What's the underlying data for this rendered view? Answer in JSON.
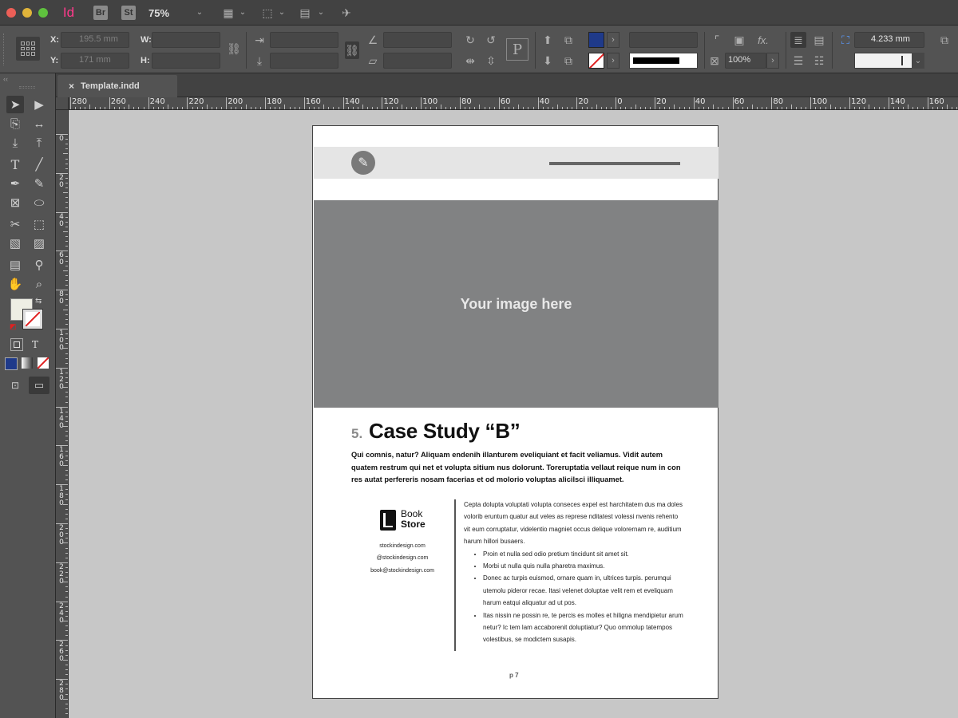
{
  "app": {
    "logo": "Id",
    "bridge": "Br",
    "stock": "St",
    "zoom": "75%"
  },
  "control": {
    "x_label": "X:",
    "y_label": "Y:",
    "w_label": "W:",
    "h_label": "H:",
    "x_value": "195.5 mm",
    "y_value": "171 mm",
    "opacity": "100%",
    "gap": "4.233 mm",
    "fill_color": "#1f3a8a"
  },
  "tab": {
    "close": "×",
    "title": "Template.indd"
  },
  "ruler": {
    "h": [
      "280",
      "260",
      "240",
      "220",
      "200",
      "180",
      "160",
      "140",
      "120",
      "100",
      "80",
      "60",
      "40",
      "20",
      "0",
      "20",
      "40",
      "60",
      "80",
      "100",
      "120",
      "140",
      "160",
      "1"
    ],
    "v": [
      "0",
      "20",
      "40",
      "60",
      "80",
      "100",
      "120",
      "140",
      "160",
      "180",
      "200",
      "220",
      "240",
      "260",
      "280"
    ]
  },
  "doc": {
    "image_placeholder": "Your image here",
    "case_number": "5.",
    "case_title": "Case Study “B”",
    "intro": "Qui comnis, natur? Aliquam endenih illanturem eveliquiant et facit veliamus. Vidit autem quatem restrum qui net et volupta sitium nus dolorunt. Toreruptatia vellaut reique num in con res autat perfereris nosam facerias et od molorio voluptas alicilsci illiquamet.",
    "book_line1": "Book",
    "book_line2": "Store",
    "site": "stockindesign.com",
    "handle": "@stockindesign.com",
    "email": "book@stockindesign.com",
    "body": "Cepta dolupta voluptati volupta conseces expel est harchitatem dus ma doles volorib eruntum quatur aut veles as represe nditatest volessi nvenis rehento vit eum corruptatur, videlentio magniet occus delique volorernam re, auditium harum hillori busaers.",
    "bullets": [
      "Proin et nulla sed odio pretium tincidunt sit amet sit.",
      "Morbi ut nulla quis nulla pharetra maximus.",
      "Donec ac turpis euismod, ornare quam in, ultrices turpis. perumqui utemolu pideror recae. Itasi velenet doluptae velit rem et eveliquam harum eatqui aliquatur ad ut pos.",
      "Itas nissin ne possin re, te percis es molles et hiligna mendipietur arum netur? Ic tem lam accaborenit doluptiatur? Quo ommolup tatempos volestibus, se modictem susapis."
    ],
    "page_number": "p 7"
  }
}
